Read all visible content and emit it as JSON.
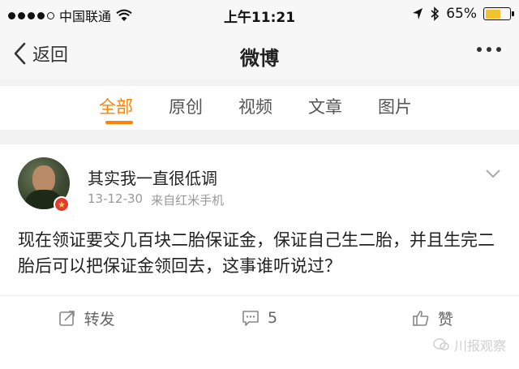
{
  "status_bar": {
    "carrier": "中国联通",
    "time": "上午11:21",
    "battery": "65%",
    "battery_level": 0.65
  },
  "nav": {
    "back_label": "返回",
    "title": "微博"
  },
  "tabs": [
    {
      "label": "全部",
      "active": true
    },
    {
      "label": "原创",
      "active": false
    },
    {
      "label": "视频",
      "active": false
    },
    {
      "label": "文章",
      "active": false
    },
    {
      "label": "图片",
      "active": false
    }
  ],
  "post": {
    "username": "其实我一直很低调",
    "date": "13-12-30",
    "source": "来自红米手机",
    "text": "现在领证要交几百块二胎保证金，保证自己生二胎，并且生完二胎后可以把保证金领回去，这事谁听说过？",
    "actions": {
      "repost_label": "转发",
      "comment_count": "5",
      "like_label": "赞"
    }
  },
  "watermark": "川报观察",
  "colors": {
    "accent": "#ff8200",
    "badge": "#e23c2c"
  }
}
